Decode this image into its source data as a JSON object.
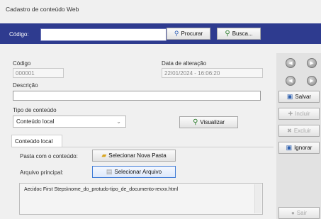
{
  "window": {
    "title": "Cadastro de conteúdo Web"
  },
  "search": {
    "label": "Código:",
    "value": "",
    "procurar_label": "Procurar",
    "busca_label": "Busca..."
  },
  "form": {
    "codigo_label": "Código",
    "codigo_value": "000001",
    "data_label": "Data de alteração",
    "data_value": "22/01/2024 - 16:06:20",
    "descricao_label": "Descrição",
    "descricao_value": "",
    "tipo_label": "Tipo de conteúdo",
    "tipo_value": "Conteúdo local",
    "visualizar_label": "Visualizar"
  },
  "tab": {
    "label": "Conteúdo local",
    "pasta_label": "Pasta com o conteúdo:",
    "nova_pasta_label": "Selecionar Nova Pasta",
    "arquivo_label": "Arquivo principal:",
    "selecionar_arquivo_label": "Selecionar Arquivo",
    "path_value": "Aecidoc First Steps\\nome_do_protudo-tipo_de_documento-revxx.html"
  },
  "side": {
    "salvar": "Salvar",
    "incluir": "Incluir",
    "excluir": "Excluir",
    "ignorar": "Ignorar",
    "sair": "Sair"
  },
  "colors": {
    "topbar": "#2e3b8f",
    "panel": "#f0f0f0",
    "sidebar": "#e2e2e2"
  }
}
